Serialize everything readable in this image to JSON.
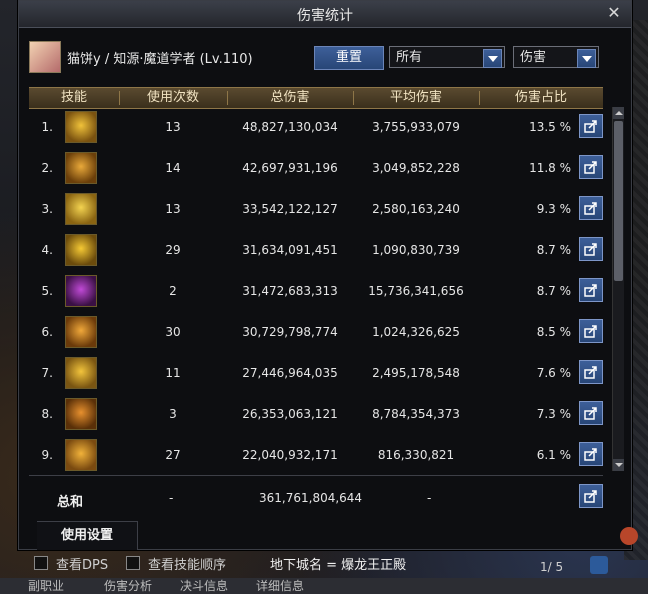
{
  "window": {
    "title": "伤害统计"
  },
  "header": {
    "character": "猫饼y / 知源·魔道学者 (Lv.110)",
    "reset_label": "重置",
    "filter_value": "所有",
    "mode_value": "伤害"
  },
  "columns": [
    "技能",
    "使用次数",
    "总伤害",
    "平均伤害",
    "伤害占比"
  ],
  "rows": [
    {
      "rank": "1.",
      "icon": "spiral-skill-icon",
      "uses": "13",
      "total": "48,827,130,034",
      "avg": "3,755,933,079",
      "share": "13.5 %"
    },
    {
      "rank": "2.",
      "icon": "cauldron-skill-icon",
      "uses": "14",
      "total": "42,697,931,196",
      "avg": "3,049,852,228",
      "share": "11.8 %"
    },
    {
      "rank": "3.",
      "icon": "sparkle-skill-icon",
      "uses": "13",
      "total": "33,542,122,127",
      "avg": "2,580,163,240",
      "share": "9.3 %"
    },
    {
      "rank": "4.",
      "icon": "cloud-skill-icon",
      "uses": "29",
      "total": "31,634,091,451",
      "avg": "1,090,830,739",
      "share": "8.7 %"
    },
    {
      "rank": "5.",
      "icon": "magic-storm-skill-icon",
      "uses": "2",
      "total": "31,472,683,313",
      "avg": "15,736,341,656",
      "share": "8.7 %"
    },
    {
      "rank": "6.",
      "icon": "pumpkin-skill-icon",
      "uses": "30",
      "total": "30,729,798,774",
      "avg": "1,024,326,625",
      "share": "8.5 %"
    },
    {
      "rank": "7.",
      "icon": "sun-skill-icon",
      "uses": "11",
      "total": "27,446,964,035",
      "avg": "2,495,178,548",
      "share": "7.6 %"
    },
    {
      "rank": "8.",
      "icon": "compass-skill-icon",
      "uses": "3",
      "total": "26,353,063,121",
      "avg": "8,784,354,373",
      "share": "7.3 %"
    },
    {
      "rank": "9.",
      "icon": "arch-skill-icon",
      "uses": "27",
      "total": "22,040,932,171",
      "avg": "816,330,821",
      "share": "6.1 %"
    }
  ],
  "total": {
    "label": "总和",
    "uses": "-",
    "value": "361,761,804,644",
    "avg": "-"
  },
  "settings_tab": "使用设置",
  "footer": {
    "check_dps": "查看DPS",
    "check_order": "查看技能顺序",
    "dungeon": "地下城名 = 爆龙王正殿",
    "page": "1/ 5"
  },
  "bottom_tabs": [
    "副职业",
    "伤害分析",
    "决斗信息",
    "详细信息"
  ],
  "colors": {
    "accent_blue": "#2f4f86",
    "header_gold": "#5a4a2f"
  }
}
